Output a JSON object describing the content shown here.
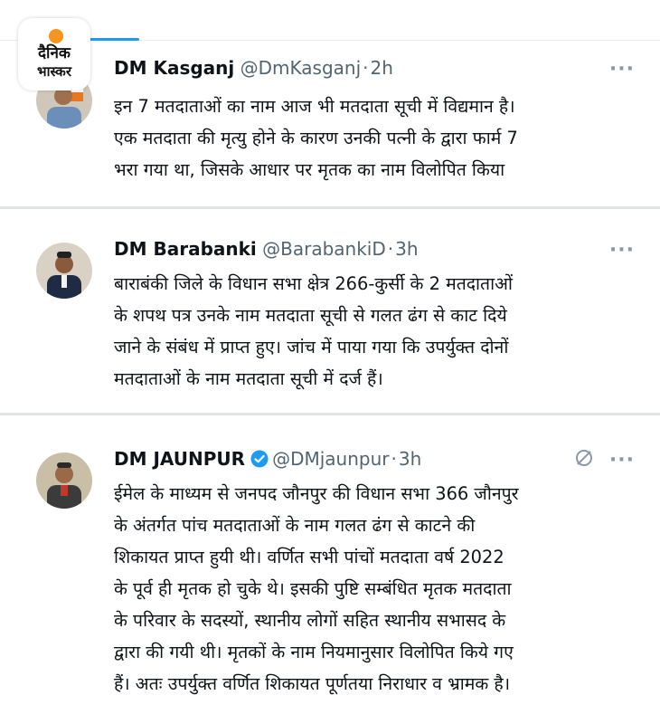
{
  "brand": {
    "line1": "दैनिक",
    "line2": "भास्कर",
    "accent": "#f7941d"
  },
  "more_glyph": "···",
  "tweets": [
    {
      "name": "DM Kasganj",
      "handle": "@DmKasganj",
      "separator": "·",
      "time": "2h",
      "lines": [
        "इन 7 मतदाताओं का नाम आज भी मतदाता सूची में विद्यमान है।",
        "एक मतदाता की मृत्यु होने के कारण उनकी पत्नी के द्वारा फार्म 7",
        "भरा गया था, जिसके आधार पर मृतक का नाम विलोपित किया"
      ]
    },
    {
      "name": "DM Barabanki",
      "handle": "@BarabankiD",
      "separator": "·",
      "time": "3h",
      "lines": [
        "बाराबंकी जिले के विधान सभा क्षेत्र 266-कुर्सी के 2 मतदाताओं",
        "के शपथ पत्र उनके नाम मतदाता सूची से गलत ढंग से काट दिये",
        "जाने के संबंध में प्राप्त हुए। जांच में पाया गया कि उपर्युक्त दोनों",
        "मतदाताओं के नाम मतदाता सूची में दर्ज हैं।"
      ]
    },
    {
      "name": "DM JAUNPUR",
      "handle": "@DMjaunpur",
      "separator": "·",
      "time": "3h",
      "verified": true,
      "lines": [
        "ईमेल के माध्यम से  जनपद जौनपुर की विधान सभा 366 जौनपुर",
        "के अंतर्गत पांच मतदाताओं के नाम गलत ढंग से काटने की",
        "शिकायत  प्राप्त हुयी थी। वर्णित सभी पांचों मतदाता वर्ष 2022",
        "के पूर्व ही मृतक हो चुके थे। इसकी पुष्टि सम्बंधित मृतक मतदाता",
        "के परिवार के सदस्यों, स्थानीय लोगों सहित स्थानीय सभासद के",
        "द्वारा की गयी थी। मृतकों के नाम नियमानुसार विलोपित किये गए",
        "हैं। अतः उपर्युक्त वर्णित शिकायत पूर्णतया निराधार व भ्रामक है।"
      ]
    }
  ]
}
